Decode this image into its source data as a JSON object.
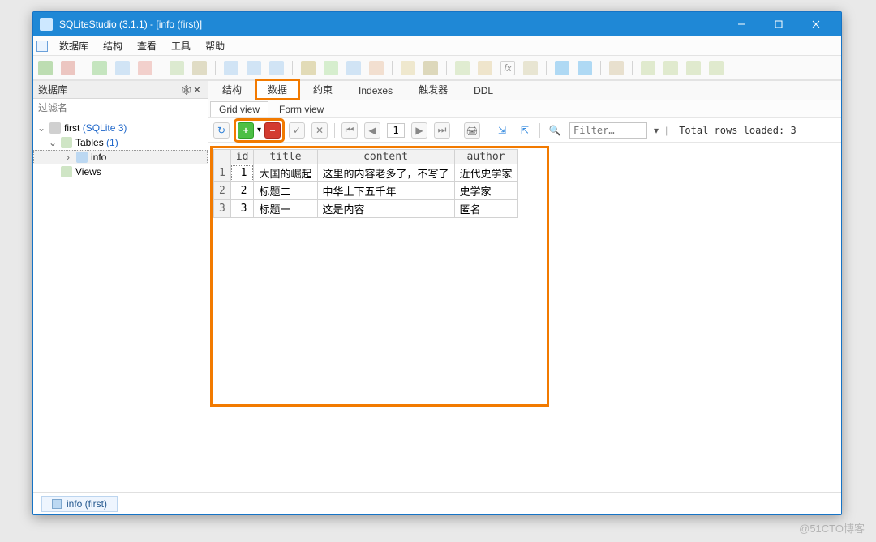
{
  "window": {
    "title": "SQLiteStudio (3.1.1) - [info (first)]"
  },
  "menus": {
    "db": "数据库",
    "struct": "结构",
    "view": "查看",
    "tools": "工具",
    "help": "帮助"
  },
  "sidebar": {
    "title": "数据库",
    "filter_placeholder": "过滤名",
    "db_name": "first",
    "db_kind": "(SQLite 3)",
    "tables_label": "Tables",
    "tables_count": "(1)",
    "tables": [
      {
        "name": "info"
      }
    ],
    "views_label": "Views"
  },
  "tabs": {
    "struct": "结构",
    "data": "数据",
    "constraints": "约束",
    "indexes": "Indexes",
    "triggers": "触发器",
    "ddl": "DDL"
  },
  "subtabs": {
    "grid": "Grid view",
    "form": "Form view"
  },
  "databar": {
    "page": "1",
    "filter_placeholder": "Filter…",
    "rows_label": "Total rows loaded: 3"
  },
  "grid": {
    "columns": [
      "id",
      "title",
      "content",
      "author"
    ],
    "rows": [
      {
        "n": "1",
        "id": "1",
        "title": "大国的崛起",
        "content": "这里的内容老多了，不写了",
        "author": "近代史学家"
      },
      {
        "n": "2",
        "id": "2",
        "title": "标题二",
        "content": "中华上下五千年",
        "author": "史学家"
      },
      {
        "n": "3",
        "id": "3",
        "title": "标题一",
        "content": "这是内容",
        "author": "匿名"
      }
    ]
  },
  "status": {
    "tab": "info (first)"
  },
  "watermark": "@51CTO博客",
  "icons": {
    "refresh": "↻",
    "add": "+",
    "remove": "−",
    "commit": "✓",
    "rollback": "✕",
    "first": "⏮",
    "prev": "◀",
    "next": "▶",
    "last": "⏭",
    "print": "🖨",
    "align_in": "⇲",
    "align_out": "⇱",
    "search": "🔍",
    "dd": "▾"
  }
}
